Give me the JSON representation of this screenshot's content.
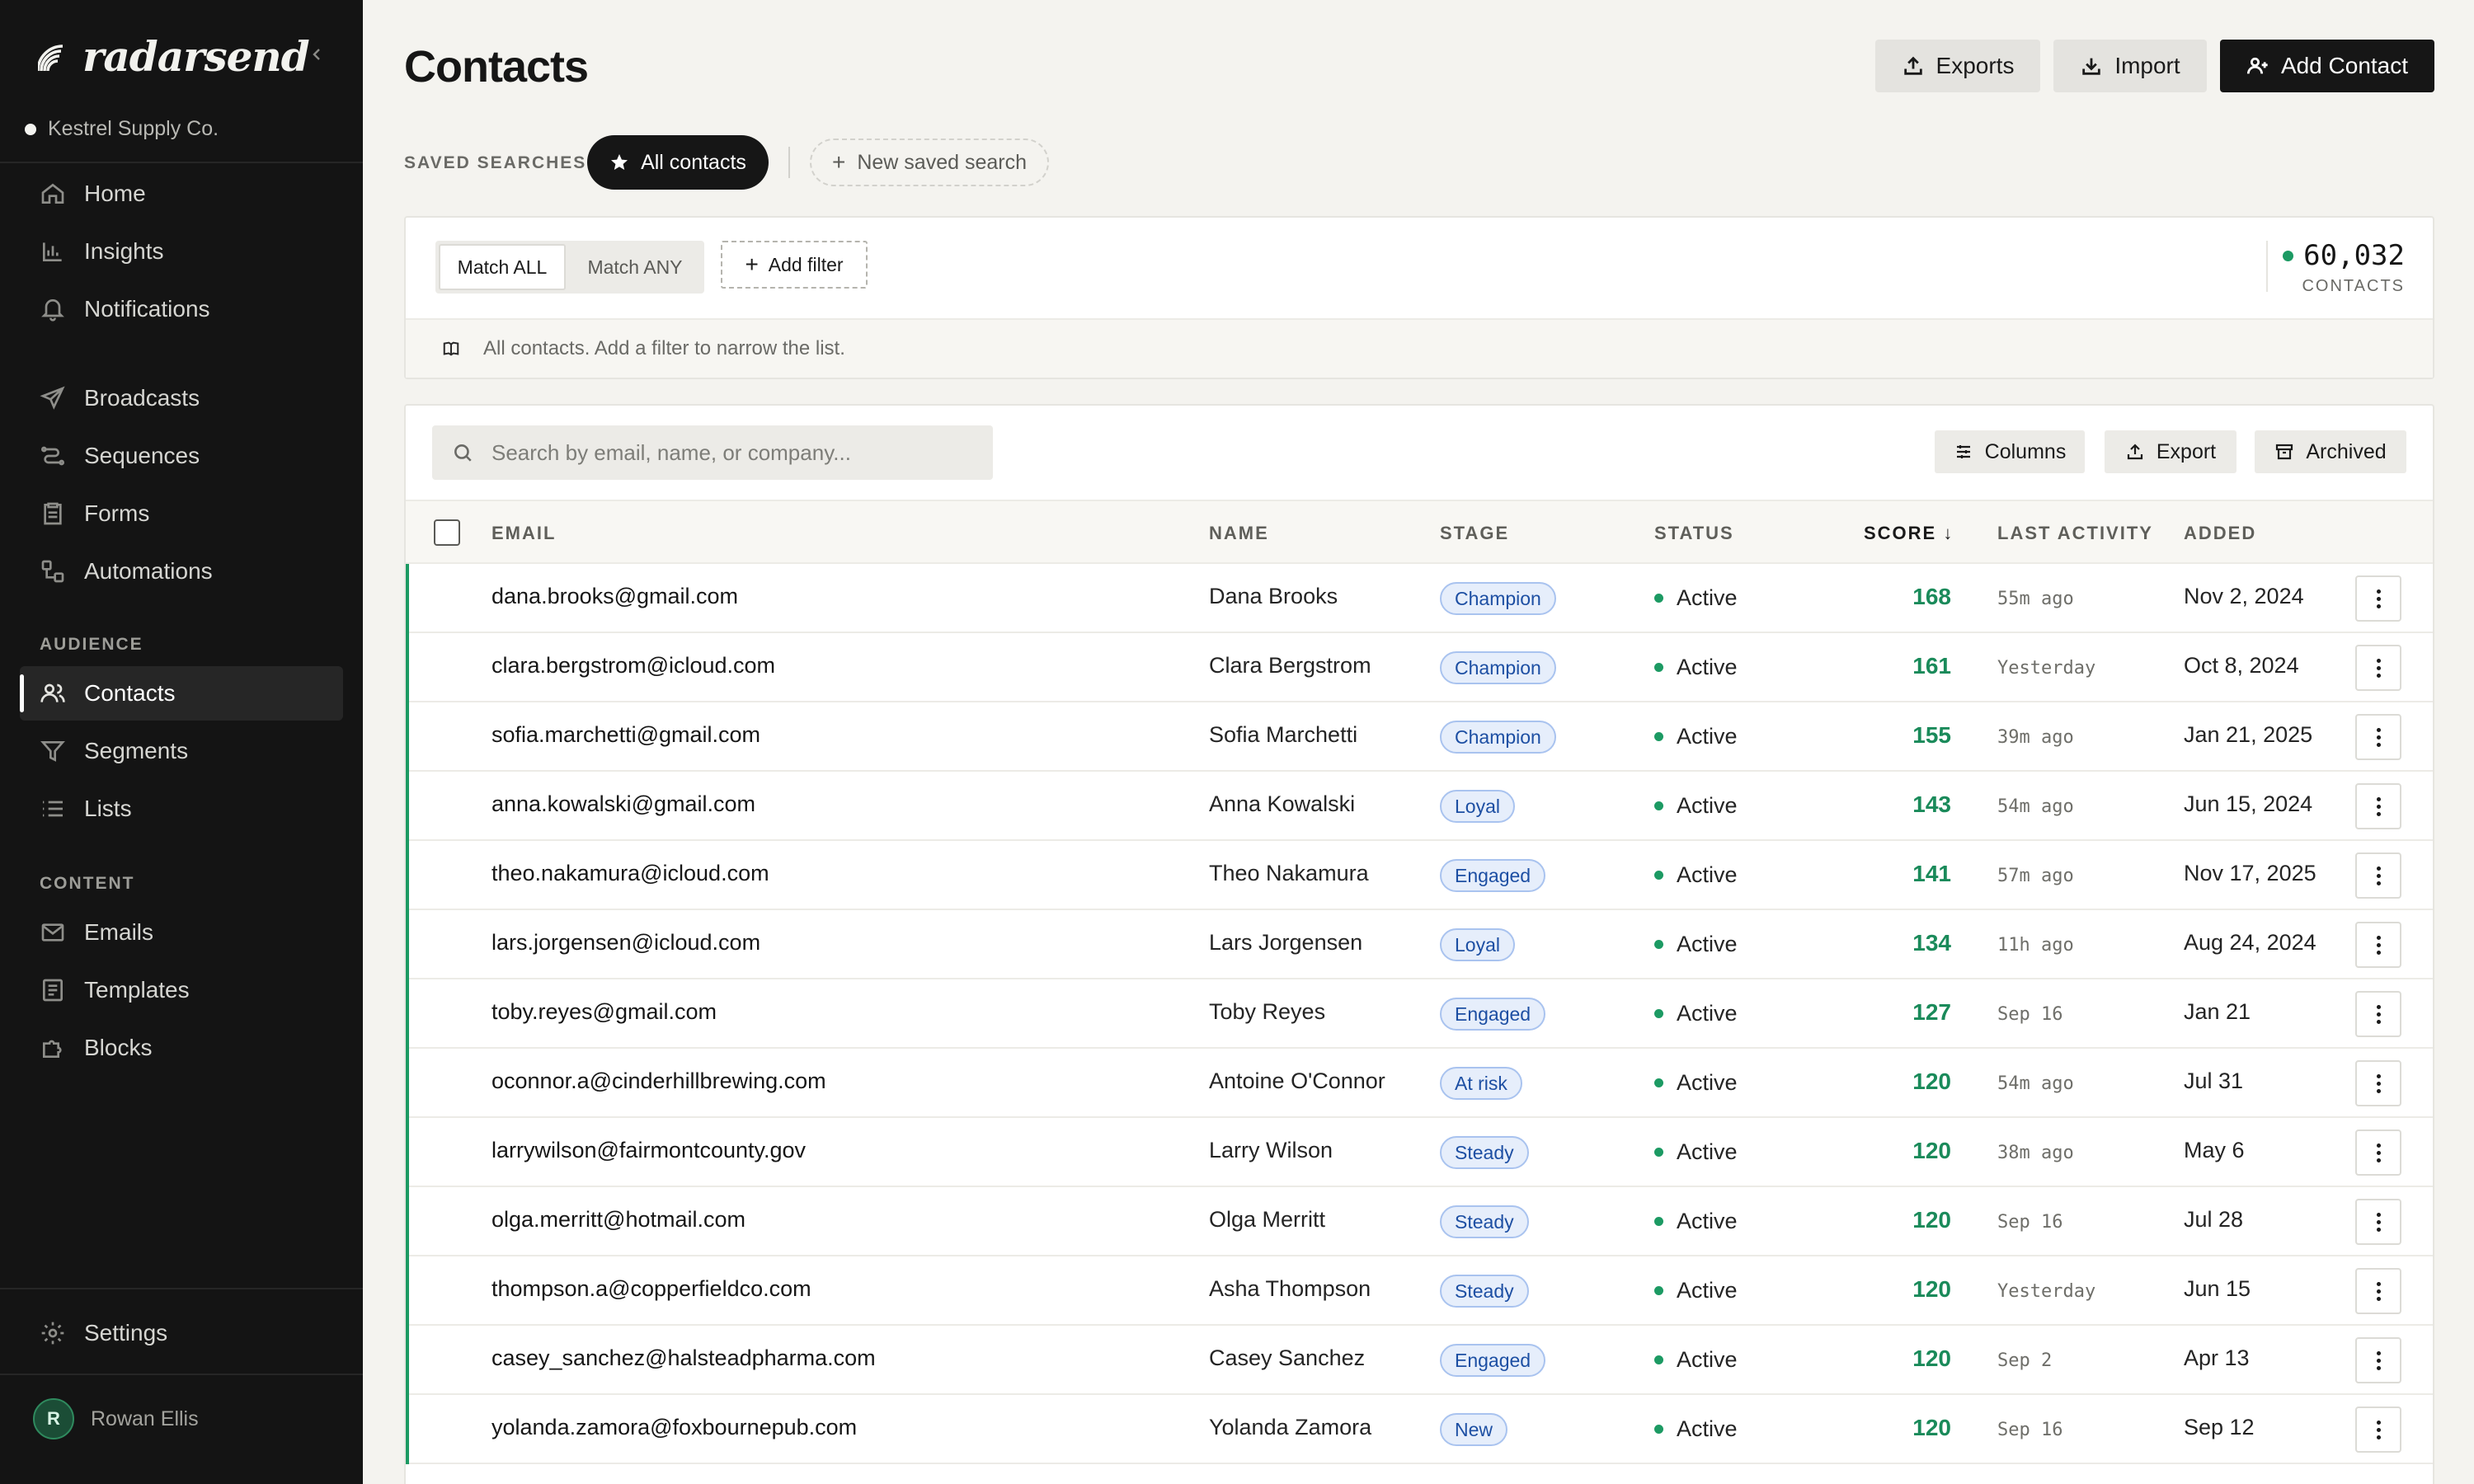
{
  "brand": {
    "name": "radarsend"
  },
  "workspace": {
    "name": "Kestrel Supply Co."
  },
  "nav": {
    "primary": [
      {
        "label": "Home",
        "icon": "home-icon"
      },
      {
        "label": "Insights",
        "icon": "bar-chart-icon"
      },
      {
        "label": "Notifications",
        "icon": "bell-icon"
      }
    ],
    "engage": [
      {
        "label": "Broadcasts",
        "icon": "send-icon"
      },
      {
        "label": "Sequences",
        "icon": "sequence-icon"
      },
      {
        "label": "Forms",
        "icon": "clipboard-icon"
      },
      {
        "label": "Automations",
        "icon": "workflow-icon"
      }
    ],
    "audience_title": "AUDIENCE",
    "audience": [
      {
        "label": "Contacts",
        "icon": "users-icon",
        "active": true
      },
      {
        "label": "Segments",
        "icon": "filter-icon"
      },
      {
        "label": "Lists",
        "icon": "list-icon"
      }
    ],
    "content_title": "CONTENT",
    "content": [
      {
        "label": "Emails",
        "icon": "mail-icon"
      },
      {
        "label": "Templates",
        "icon": "template-icon"
      },
      {
        "label": "Blocks",
        "icon": "puzzle-icon"
      }
    ],
    "settings": {
      "label": "Settings",
      "icon": "gear-icon"
    }
  },
  "user": {
    "initial": "R",
    "name": "Rowan Ellis"
  },
  "header": {
    "title": "Contacts",
    "exports_label": "Exports",
    "import_label": "Import",
    "add_label": "Add Contact"
  },
  "saved_searches": {
    "label": "SAVED SEARCHES",
    "active": "All contacts",
    "new_label": "New saved search"
  },
  "filters": {
    "match_all": "Match ALL",
    "match_any": "Match ANY",
    "selected_match": "Match ALL",
    "add_filter": "Add filter",
    "hint": "All contacts. Add a filter to narrow the list.",
    "count": "60,032",
    "count_label": "CONTACTS"
  },
  "table_toolbar": {
    "search_placeholder": "Search by email, name, or company...",
    "columns_label": "Columns",
    "export_label": "Export",
    "archived_label": "Archived"
  },
  "columns": {
    "email": "EMAIL",
    "name": "NAME",
    "stage": "STAGE",
    "status": "STATUS",
    "score": "SCORE",
    "score_sort": "↓",
    "last_activity": "LAST ACTIVITY",
    "added": "ADDED"
  },
  "rows": [
    {
      "email": "dana.brooks@gmail.com",
      "name": "Dana Brooks",
      "stage": "Champion",
      "status": "Active",
      "score": "168",
      "activity": "55m ago",
      "added": "Nov 2, 2024"
    },
    {
      "email": "clara.bergstrom@icloud.com",
      "name": "Clara Bergstrom",
      "stage": "Champion",
      "status": "Active",
      "score": "161",
      "activity": "Yesterday",
      "added": "Oct 8, 2024"
    },
    {
      "email": "sofia.marchetti@gmail.com",
      "name": "Sofia Marchetti",
      "stage": "Champion",
      "status": "Active",
      "score": "155",
      "activity": "39m ago",
      "added": "Jan 21, 2025"
    },
    {
      "email": "anna.kowalski@gmail.com",
      "name": "Anna Kowalski",
      "stage": "Loyal",
      "status": "Active",
      "score": "143",
      "activity": "54m ago",
      "added": "Jun 15, 2024"
    },
    {
      "email": "theo.nakamura@icloud.com",
      "name": "Theo Nakamura",
      "stage": "Engaged",
      "status": "Active",
      "score": "141",
      "activity": "57m ago",
      "added": "Nov 17, 2025"
    },
    {
      "email": "lars.jorgensen@icloud.com",
      "name": "Lars Jorgensen",
      "stage": "Loyal",
      "status": "Active",
      "score": "134",
      "activity": "11h ago",
      "added": "Aug 24, 2024"
    },
    {
      "email": "toby.reyes@gmail.com",
      "name": "Toby Reyes",
      "stage": "Engaged",
      "status": "Active",
      "score": "127",
      "activity": "Sep 16",
      "added": "Jan 21"
    },
    {
      "email": "oconnor.a@cinderhillbrewing.com",
      "name": "Antoine O'Connor",
      "stage": "At risk",
      "status": "Active",
      "score": "120",
      "activity": "54m ago",
      "added": "Jul 31"
    },
    {
      "email": "larrywilson@fairmontcounty.gov",
      "name": "Larry Wilson",
      "stage": "Steady",
      "status": "Active",
      "score": "120",
      "activity": "38m ago",
      "added": "May 6"
    },
    {
      "email": "olga.merritt@hotmail.com",
      "name": "Olga Merritt",
      "stage": "Steady",
      "status": "Active",
      "score": "120",
      "activity": "Sep 16",
      "added": "Jul 28"
    },
    {
      "email": "thompson.a@copperfieldco.com",
      "name": "Asha Thompson",
      "stage": "Steady",
      "status": "Active",
      "score": "120",
      "activity": "Yesterday",
      "added": "Jun 15"
    },
    {
      "email": "casey_sanchez@halsteadpharma.com",
      "name": "Casey Sanchez",
      "stage": "Engaged",
      "status": "Active",
      "score": "120",
      "activity": "Sep 2",
      "added": "Apr 13"
    },
    {
      "email": "yolanda.zamora@foxbournepub.com",
      "name": "Yolanda Zamora",
      "stage": "New",
      "status": "Active",
      "score": "120",
      "activity": "Sep 16",
      "added": "Sep 12"
    }
  ],
  "colors": {
    "accent_green": "#1c9a63",
    "sidebar_bg": "#141414",
    "stage_badge_bg": "#e6eefb",
    "stage_badge_text": "#1d4fa3"
  }
}
